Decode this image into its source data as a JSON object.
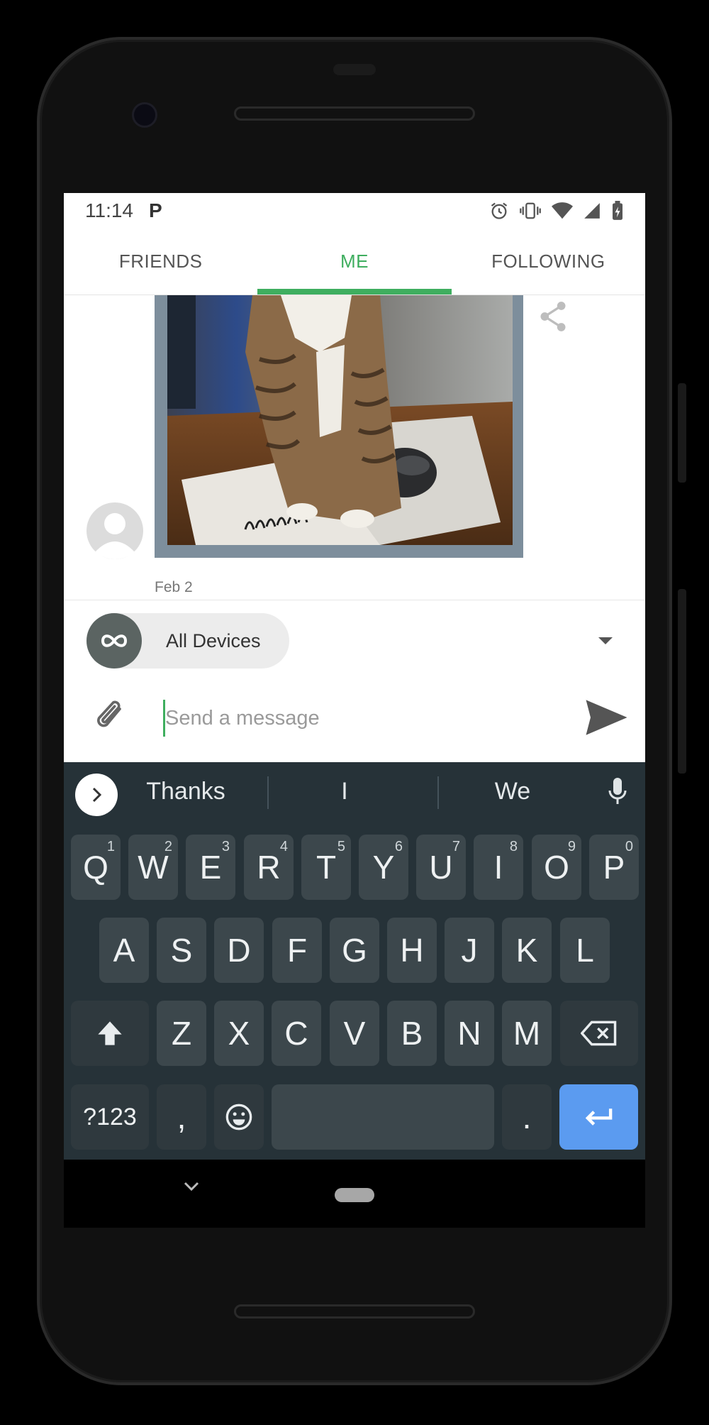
{
  "status_bar": {
    "time": "11:14",
    "p_badge": "P"
  },
  "tabs": [
    {
      "label": "FRIENDS",
      "active": false
    },
    {
      "label": "ME",
      "active": true
    },
    {
      "label": "FOLLOWING",
      "active": false
    }
  ],
  "post": {
    "date": "Feb 2"
  },
  "device_selector": {
    "label": "All Devices"
  },
  "compose": {
    "placeholder": "Send a message",
    "value": ""
  },
  "keyboard": {
    "suggestions": [
      "Thanks",
      "I",
      "We"
    ],
    "row1": [
      {
        "k": "Q",
        "n": "1"
      },
      {
        "k": "W",
        "n": "2"
      },
      {
        "k": "E",
        "n": "3"
      },
      {
        "k": "R",
        "n": "4"
      },
      {
        "k": "T",
        "n": "5"
      },
      {
        "k": "Y",
        "n": "6"
      },
      {
        "k": "U",
        "n": "7"
      },
      {
        "k": "I",
        "n": "8"
      },
      {
        "k": "O",
        "n": "9"
      },
      {
        "k": "P",
        "n": "0"
      }
    ],
    "row2": [
      "A",
      "S",
      "D",
      "F",
      "G",
      "H",
      "J",
      "K",
      "L"
    ],
    "row3": [
      "Z",
      "X",
      "C",
      "V",
      "B",
      "N",
      "M"
    ],
    "row4": {
      "symbols": "?123",
      "comma": ",",
      "period": "."
    }
  },
  "colors": {
    "accent": "#3fae5f",
    "enter_key": "#5b9bf0",
    "keyboard_bg": "#263238"
  }
}
